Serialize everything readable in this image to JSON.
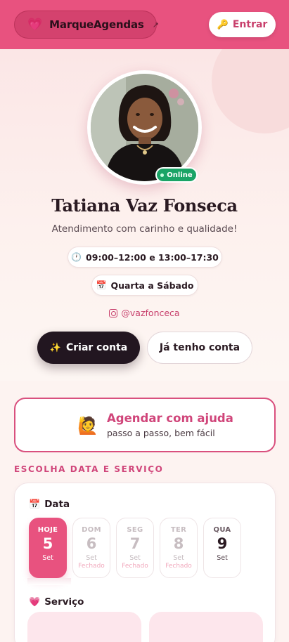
{
  "header": {
    "brand_icon": "💗",
    "brand_name": "MarqueAgendas",
    "brand_arrow": "↗",
    "login_icon": "🔑",
    "login_label": "Entrar",
    "accent_color": "#e8527f"
  },
  "profile": {
    "status": "Online",
    "name": "Tatiana Vaz Fonseca",
    "tagline": "Atendimento com carinho e qualidade!",
    "hours_icon": "🕐",
    "hours": "09:00–12:00 e 13:00–17:30",
    "days_icon": "📅",
    "days": "Quarta a Sábado",
    "instagram": "@vazfonceca"
  },
  "actions": {
    "create_icon": "✨",
    "create_label": "Criar conta",
    "have_account_label": "Já tenho conta"
  },
  "help": {
    "icon": "🙋",
    "title": "Agendar com ajuda",
    "subtitle": "passo a passo, bem fácil"
  },
  "booking": {
    "section_title": "ESCOLHA DATA E SERVIÇO",
    "date_icon": "📅",
    "date_label": "Data",
    "days": [
      {
        "weekday": "HOJE",
        "number": "5",
        "month": "Set",
        "status": ""
      },
      {
        "weekday": "DOM",
        "number": "6",
        "month": "Set",
        "status": "Fechado"
      },
      {
        "weekday": "SEG",
        "number": "7",
        "month": "Set",
        "status": "Fechado"
      },
      {
        "weekday": "TER",
        "number": "8",
        "month": "Set",
        "status": "Fechado"
      },
      {
        "weekday": "QUA",
        "number": "9",
        "month": "Set",
        "status": ""
      }
    ],
    "service_icon": "💗",
    "service_label": "Serviço"
  }
}
